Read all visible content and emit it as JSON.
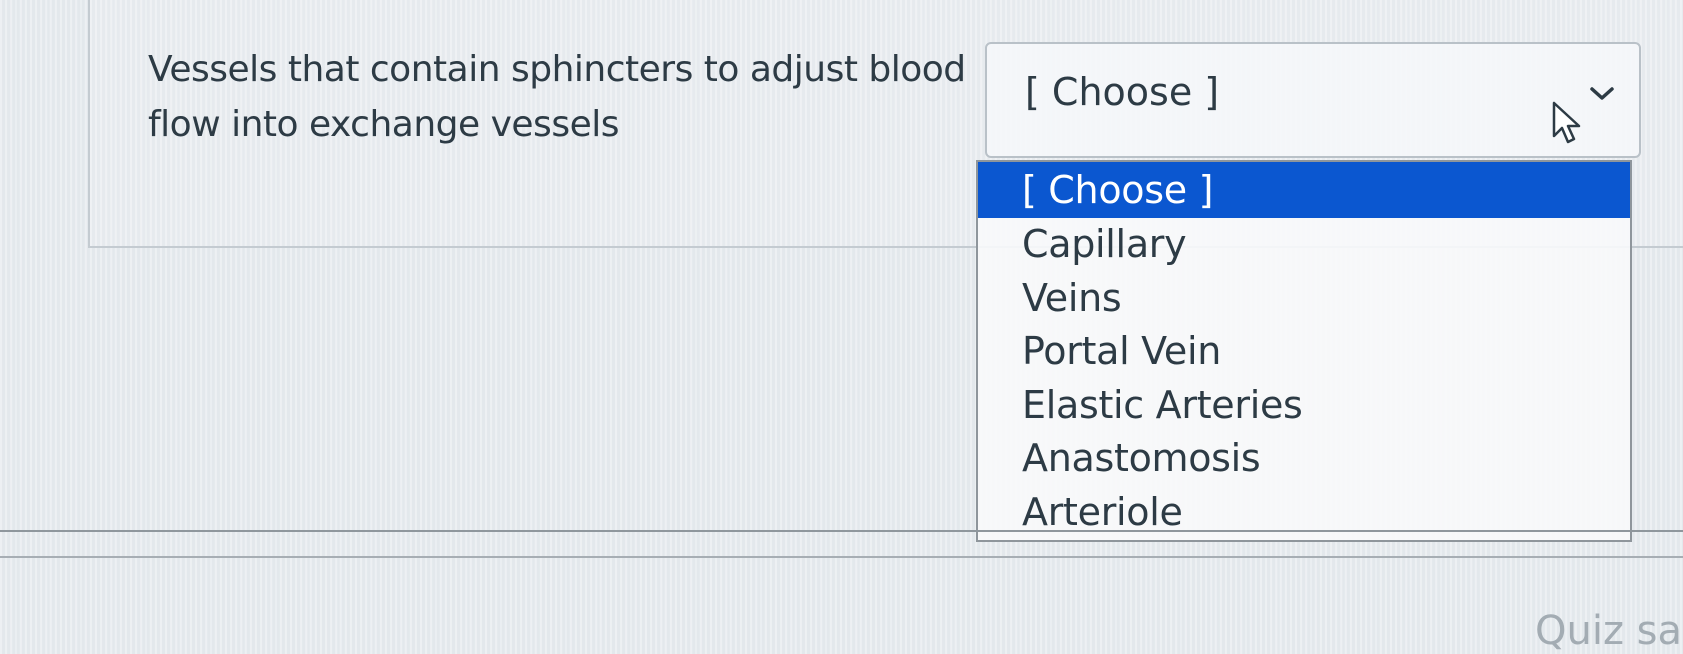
{
  "question": {
    "text": "Vessels that contain sphincters to adjust blood flow into exchange vessels"
  },
  "select": {
    "value": "[ Choose ]",
    "options": [
      "[ Choose ]",
      "Capillary",
      "Veins",
      "Portal Vein",
      "Elastic Arteries",
      "Anastomosis",
      "Arteriole"
    ],
    "highlighted_index": 0
  },
  "footer": {
    "partial_text": "Quiz sa"
  },
  "colors": {
    "highlight": "#0b57d0",
    "text": "#2d3b45"
  },
  "icons": {
    "dropdown": "chevron-down-icon",
    "pointer": "cursor-icon"
  }
}
